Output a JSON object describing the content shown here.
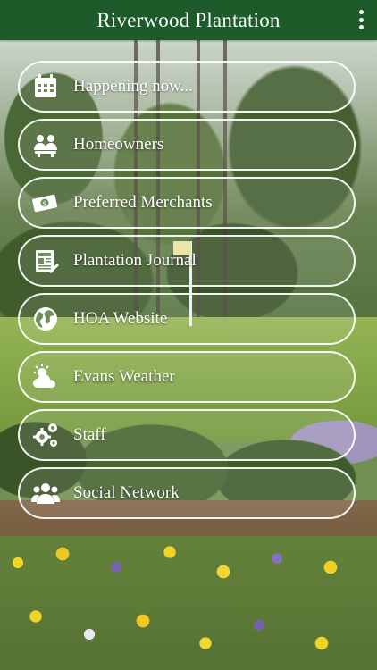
{
  "app": {
    "title": "Riverwood Plantation",
    "header_color": "#1d5c2a",
    "menu_icon": "more-vertical-icon"
  },
  "menu": {
    "items": [
      {
        "label": "Happening now...",
        "icon": "calendar-icon"
      },
      {
        "label": "Homeowners",
        "icon": "homeowners-icon"
      },
      {
        "label": "Preferred Merchants",
        "icon": "money-icon"
      },
      {
        "label": "Plantation Journal",
        "icon": "newspaper-icon"
      },
      {
        "label": "HOA Website",
        "icon": "globe-icon"
      },
      {
        "label": "Evans Weather",
        "icon": "weather-icon"
      },
      {
        "label": "Staff",
        "icon": "gears-icon"
      },
      {
        "label": "Social Network",
        "icon": "people-icon"
      }
    ]
  }
}
